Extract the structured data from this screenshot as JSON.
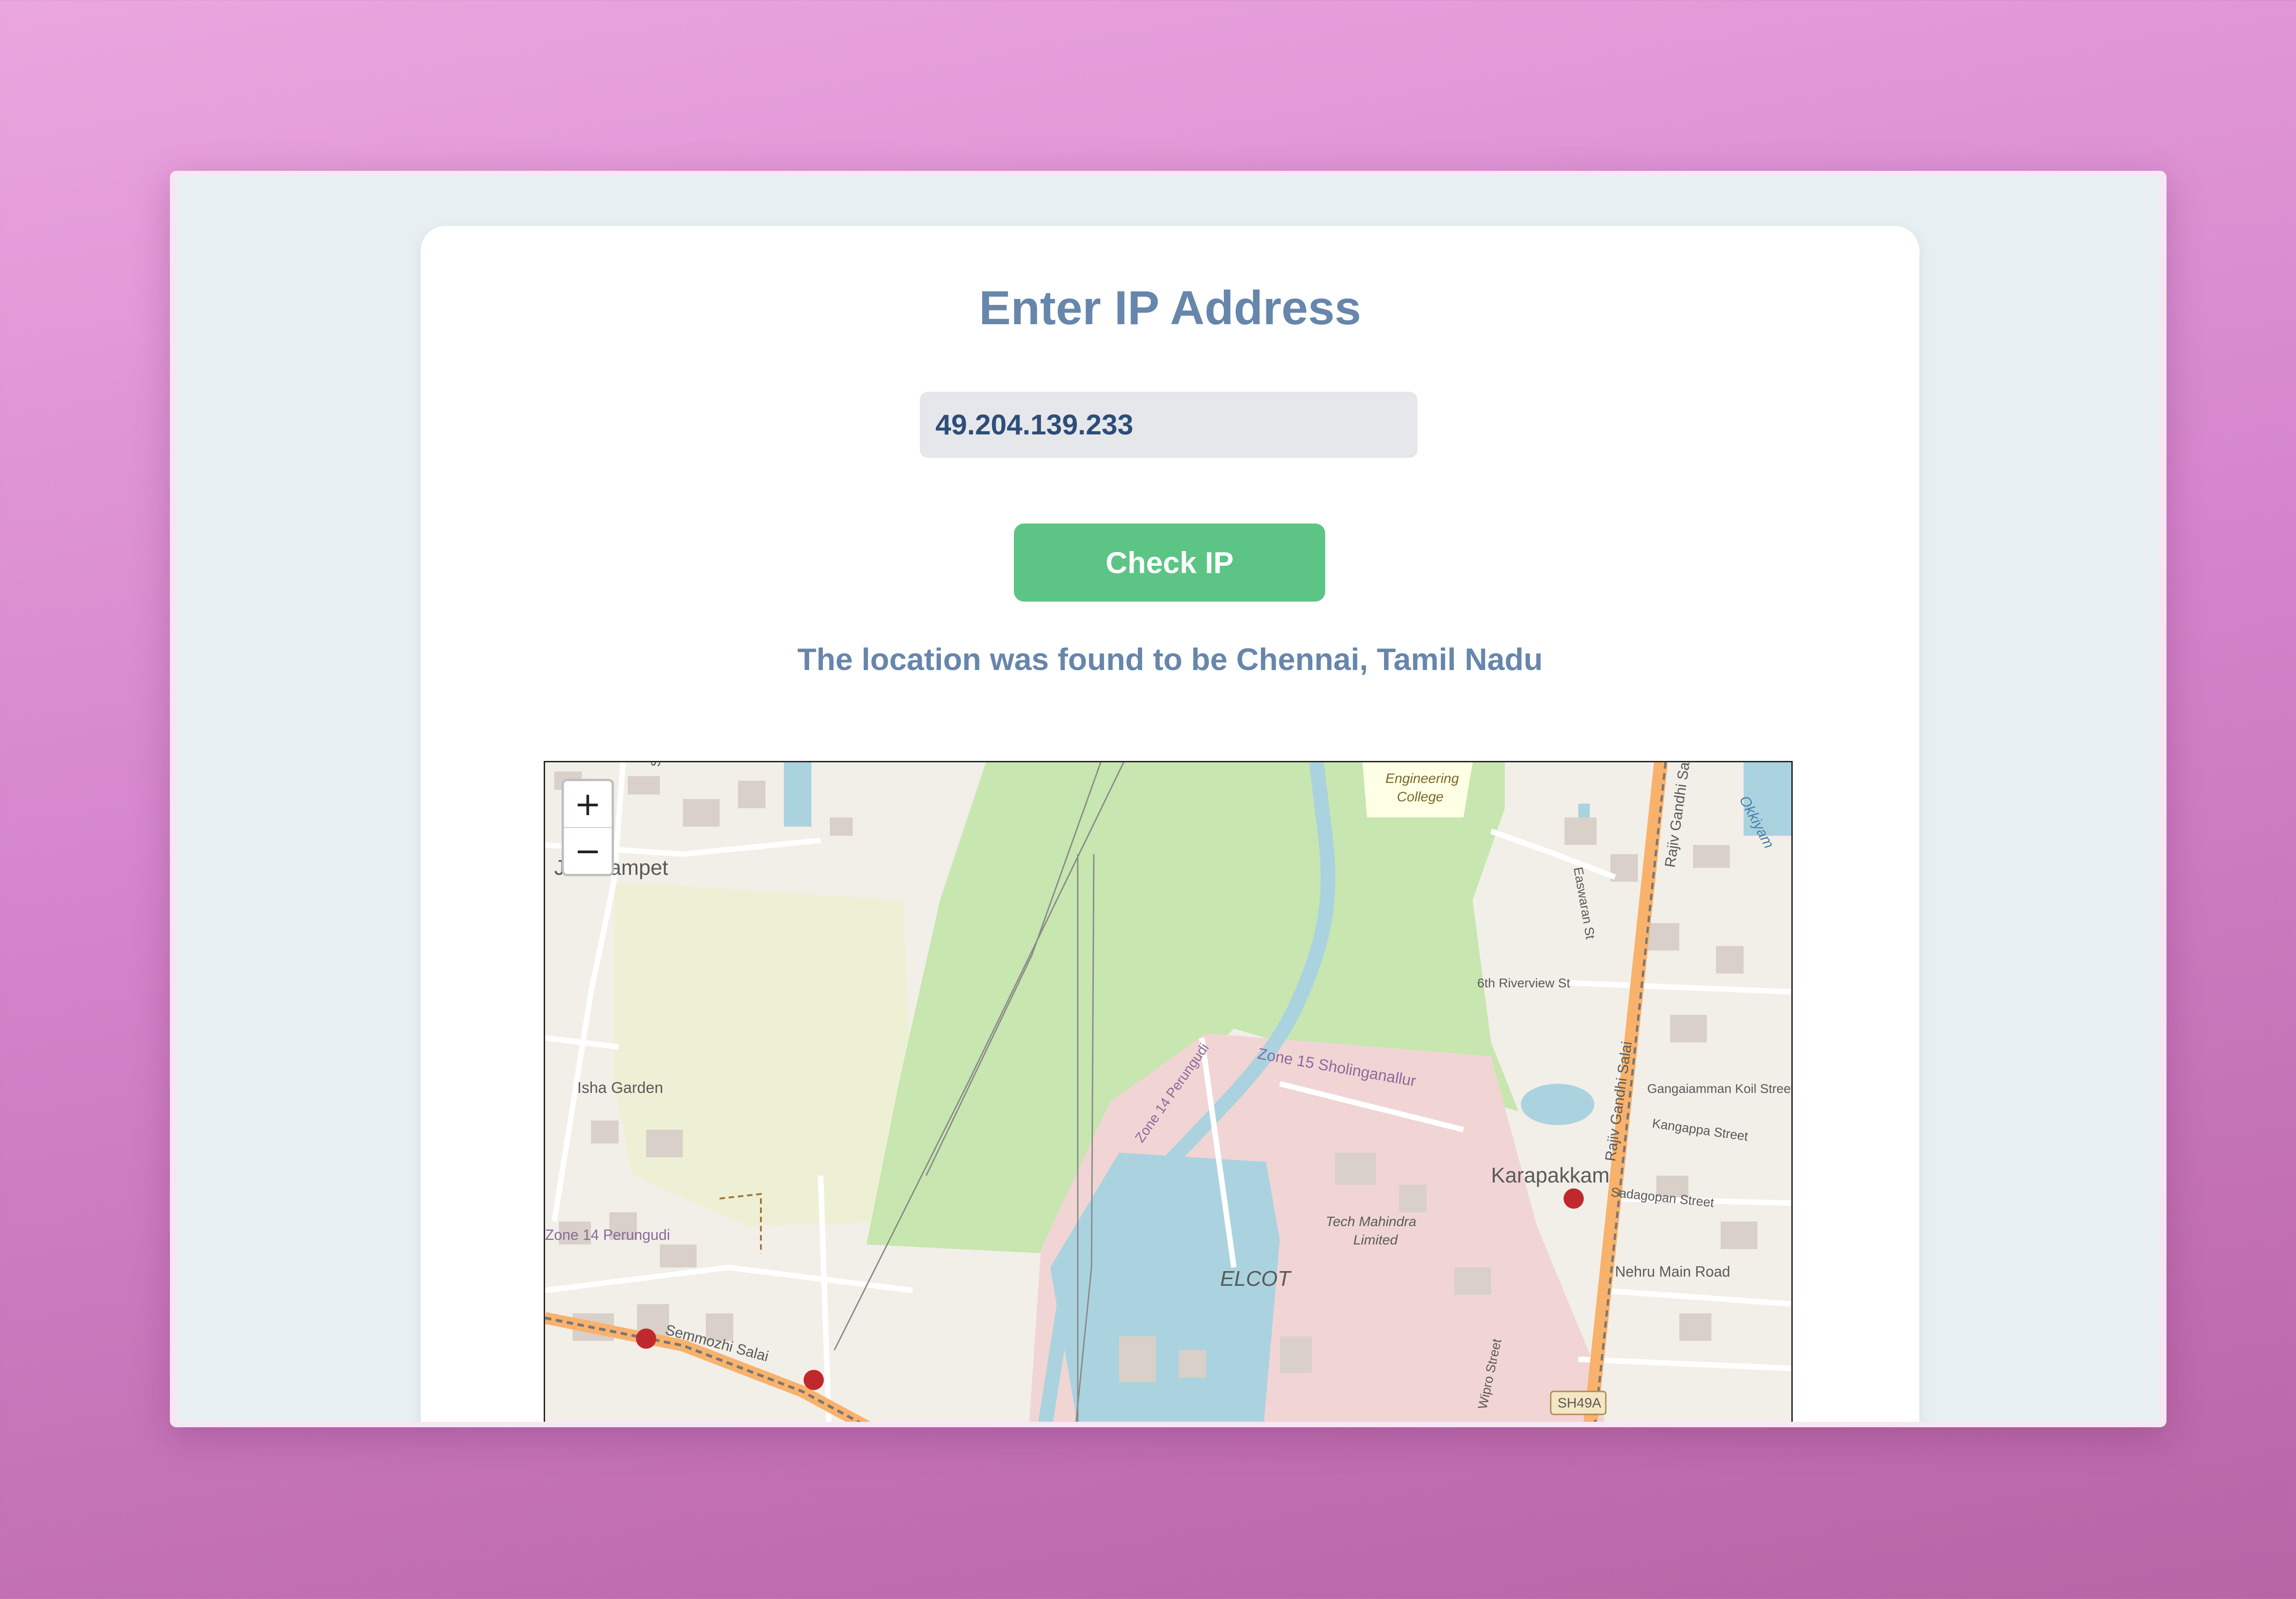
{
  "page": {
    "title": "Enter IP Address",
    "ip_value": "49.204.139.233",
    "check_button": "Check IP",
    "result_text": "The location was found to be Chennai, Tamil Nadu"
  },
  "map": {
    "zoom_in": "+",
    "zoom_out": "−",
    "labels": {
      "jalladampet": "Jalladampet",
      "isha_garden": "Isha Garden",
      "zone14": "Zone 14 Perungudi",
      "zone14_road": "Zone 14 Perungudi",
      "zone15": "Zone 15 Sholinganallur",
      "tech_mahindra_1": "Tech Mahindra",
      "tech_mahindra_2": "Limited",
      "elcot": "ELCOT",
      "karapakkam": "Karapakkam",
      "engineering_1": "Engineering",
      "engineering_2": "College",
      "riverview": "6th Riverview St",
      "easwaran": "Easwaran St",
      "rajiv1": "Rajiv Gandhi Salai",
      "rajiv2": "Rajiv Gandhi Salai",
      "gangaiamman": "Gangaiamman Koil Street",
      "kangappa": "Kangappa Street",
      "sadagopan": "Sadagopan Street",
      "nehru": "Nehru Main Road",
      "wipro": "Wipro Street",
      "semmozhi": "Semmozhi Salai",
      "sh49a": "SH49A",
      "okkiyam": "Okkiyam",
      "street": "Street"
    }
  }
}
